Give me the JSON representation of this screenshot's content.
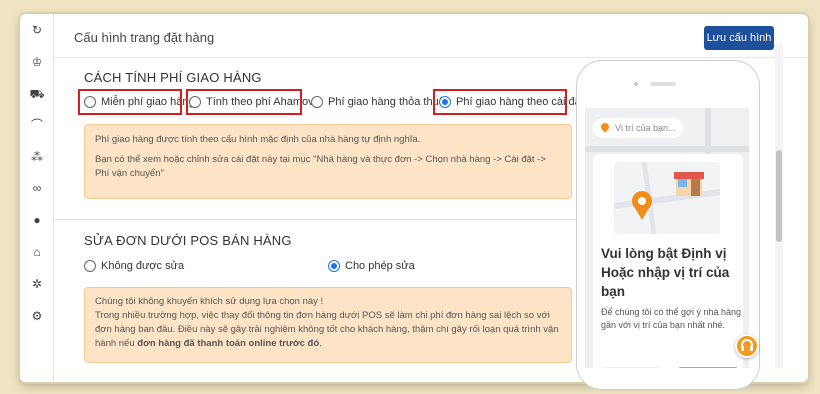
{
  "header": {
    "title": "Cấu hình trang đặt hàng",
    "save_label": "Lưu cấu hình"
  },
  "sidebar": {
    "icons": [
      "refresh-icon",
      "crown-icon",
      "truck-icon",
      "chart-icon",
      "share-icon",
      "link-icon",
      "shield-icon",
      "store-icon",
      "settings-icon",
      "gears-icon"
    ]
  },
  "shipping": {
    "title": "CÁCH TÍNH PHÍ GIAO HÀNG",
    "options": [
      {
        "label": "Miễn phí giao hàng",
        "selected": false
      },
      {
        "label": "Tính theo phí Ahamove",
        "selected": false
      },
      {
        "label": "Phí giao hàng thỏa thuận",
        "selected": false
      },
      {
        "label": "Phí giao hàng theo cài đặt",
        "selected": true
      }
    ],
    "note_line1": "Phí giao hàng được tính theo cấu hình mặc định của nhà hàng tự định nghĩa.",
    "note_line2": "Bạn có thể xem hoặc chỉnh sửa cài đặt này tại mục \"Nhà hàng và thực đơn -> Chọn nhà hàng -> Cài đặt -> Phí vận chuyển\""
  },
  "pos_edit": {
    "title": "SỬA ĐƠN DƯỚI POS BÁN HÀNG",
    "options": [
      {
        "label": "Không được sửa",
        "selected": false
      },
      {
        "label": "Cho phép sửa",
        "selected": true
      }
    ],
    "note_line1": "Chúng tôi không khuyến khích sử dụng lựa chọn này !",
    "note_line2": "Trong nhiều trường hợp, việc thay đổi thông tin đơn hàng dưới POS sẽ làm chi phí đơn hàng sai lệch so với đơn hàng ban đầu. Điều này sẽ gây trải nghiệm không tốt cho khách hàng, thậm chí gây rối loạn quá trình vận hành nếu",
    "note_bold": "đơn hàng đã thanh toán online trước đó",
    "note_end": "."
  },
  "preview": {
    "location_placeholder": "Vị trí của bạn...",
    "card_title": "Vui lòng bật Định vị Hoặc nhập vị trí của bạn",
    "card_text": "Để chúng tôi có thể gợi ý nhà hàng gần với vị trí của bạn nhất nhé."
  },
  "colors": {
    "accent": "#1a73e8",
    "primary_button": "#1e4f9c",
    "highlight": "#d61e1e",
    "note_bg": "#fde4c6",
    "brand_orange": "#f39a1f"
  }
}
